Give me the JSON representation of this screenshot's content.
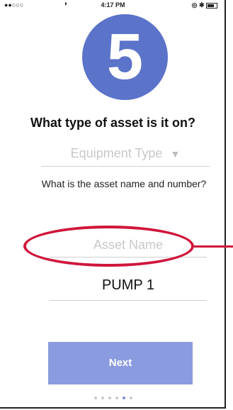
{
  "status_bar": {
    "signal": "●●○○○",
    "time": "4:17 PM"
  },
  "step": {
    "number": "5"
  },
  "asset_type": {
    "question": "What type of asset is it on?",
    "placeholder": "Equipment Type",
    "caret": "▼"
  },
  "asset_name": {
    "question": "What is the asset name and number?",
    "placeholder": "Asset Name",
    "value": "PUMP 1"
  },
  "actions": {
    "next_label": "Next"
  },
  "pagination": {
    "total": 6,
    "active_indices": [
      4,
      5
    ]
  },
  "colors": {
    "accent": "#5b73c9",
    "button": "#8b9be0",
    "highlight": "#d0163b"
  }
}
